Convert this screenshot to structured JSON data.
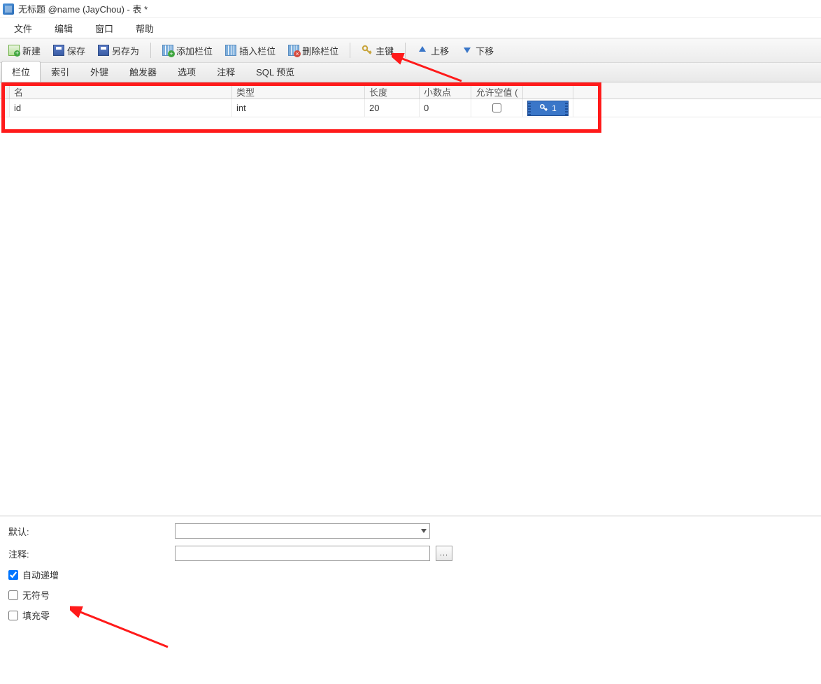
{
  "title": "无标题 @name (JayChou) - 表 *",
  "menu": {
    "file": "文件",
    "edit": "编辑",
    "window": "窗口",
    "help": "帮助"
  },
  "toolbar": {
    "new": "新建",
    "save": "保存",
    "saveas": "另存为",
    "addcol": "添加栏位",
    "insertcol": "插入栏位",
    "delcol": "删除栏位",
    "pk": "主键",
    "moveup": "上移",
    "movedown": "下移"
  },
  "tabs": {
    "fields": "栏位",
    "index": "索引",
    "fk": "外键",
    "trigger": "触发器",
    "options": "选项",
    "comment": "注释",
    "sql": "SQL 预览"
  },
  "grid": {
    "headers": {
      "name": "名",
      "type": "类型",
      "length": "长度",
      "decimal": "小数点",
      "null": "允许空值 ("
    },
    "row": {
      "name": "id",
      "type": "int",
      "length": "20",
      "decimal": "0",
      "pk": "1"
    }
  },
  "bottom": {
    "default": "默认:",
    "comment": "注释:",
    "auto_inc": "自动递增",
    "unsigned": "无符号",
    "zerofill": "填充零",
    "ellipsis": "..."
  }
}
